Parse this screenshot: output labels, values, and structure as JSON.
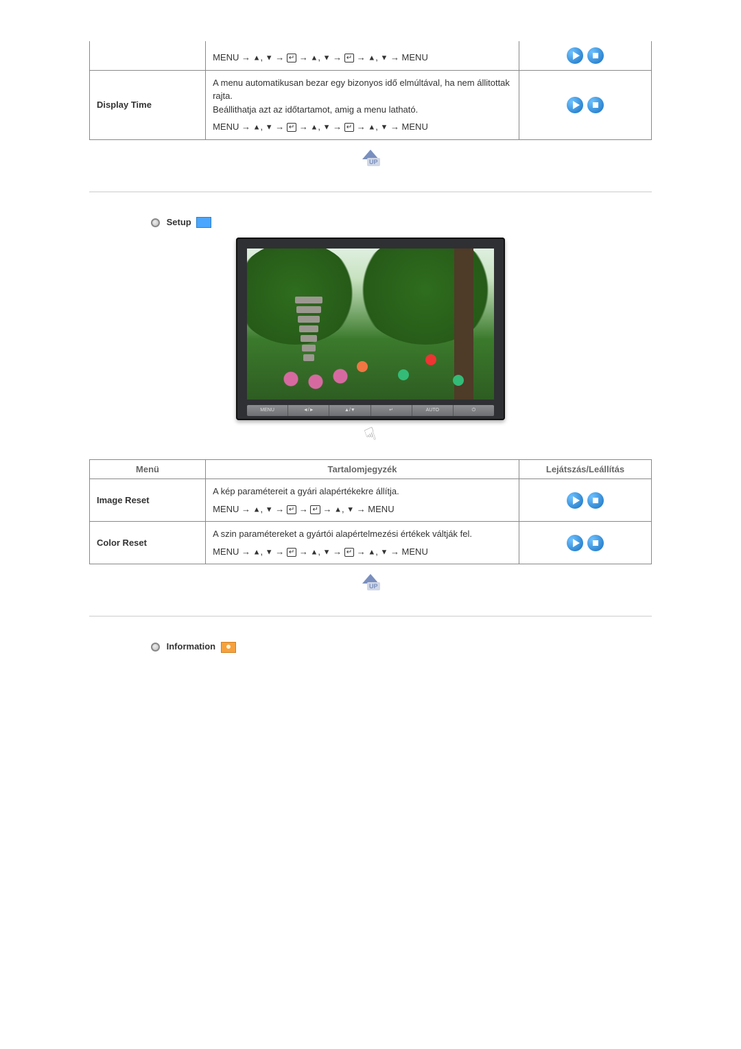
{
  "symbols": {
    "up": "▲",
    "down": "▼",
    "arrow": "→",
    "enter": "↵",
    "comma": ", "
  },
  "table1": {
    "rows": [
      {
        "label": "",
        "desc": "",
        "nav_parts": [
          "MENU",
          " → ",
          "▲",
          ", ",
          "▼",
          " → ",
          "ENTER",
          " → ",
          "▲",
          ", ",
          "▼",
          " → ",
          "ENTER",
          " → ",
          "▲",
          ", ",
          "▼",
          " → ",
          "MENU"
        ],
        "has_buttons": true
      },
      {
        "label": "Display Time",
        "desc": "A menu automatikusan bezar egy bizonyos idő elmúltával, ha nem állitottak rajta.\nBeállithatja azt az időtartamot, amig a menu latható.",
        "nav_parts": [
          "MENU",
          " → ",
          "▲",
          ", ",
          "▼",
          " → ",
          "ENTER",
          " → ",
          "▲",
          ", ",
          "▼",
          " → ",
          "ENTER",
          " → ",
          "▲",
          ", ",
          "▼",
          " → ",
          "MENU"
        ],
        "has_buttons": true
      }
    ]
  },
  "setup_title": "Setup",
  "monitor_bar": [
    "MENU",
    "◄/►",
    "▲/▼",
    "↵",
    "AUTO",
    "⏻"
  ],
  "table2": {
    "headers": {
      "menu": "Menü",
      "content": "Tartalomjegyzék",
      "play": "Lejátszás/Leállítás"
    },
    "rows": [
      {
        "label": "Image Reset",
        "desc": "A kép paramétereit a gyári alapértékekre állítja.",
        "nav_parts": [
          "MENU",
          " → ",
          "▲",
          ", ",
          "▼",
          " → ",
          "ENTER",
          " → ",
          "ENTER",
          " → ",
          "▲",
          ", ",
          "▼",
          " → ",
          "MENU"
        ]
      },
      {
        "label": "Color Reset",
        "desc": "A szin paramétereket a gyártói alapértelmezési értékek váltják fel.",
        "nav_parts": [
          "MENU",
          " → ",
          "▲",
          ", ",
          "▼",
          " → ",
          "ENTER",
          " → ",
          "▲",
          ", ",
          "▼",
          " → ",
          "ENTER",
          " → ",
          "▲",
          ", ",
          "▼",
          " → ",
          "MENU"
        ]
      }
    ]
  },
  "info_title": "Information"
}
